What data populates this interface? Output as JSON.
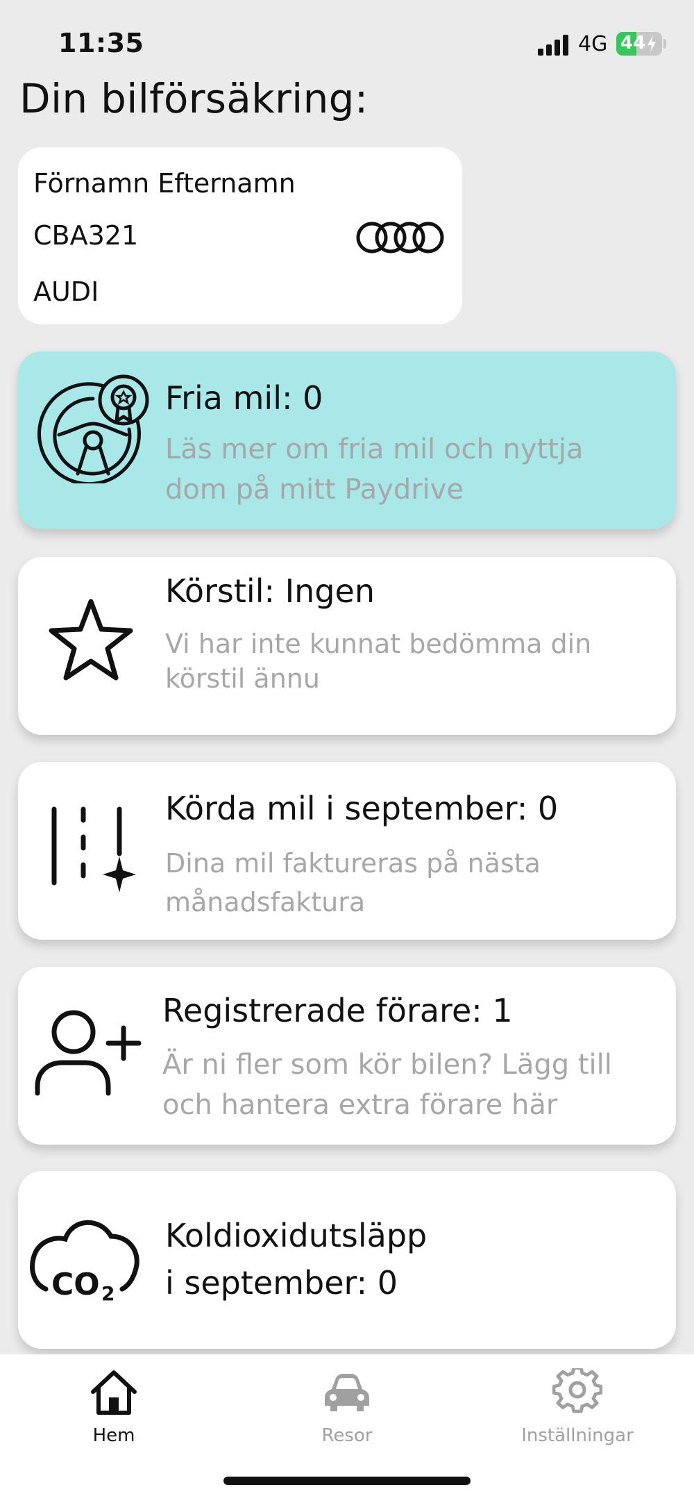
{
  "status_bar": {
    "time": "11:35",
    "network": "4G",
    "battery": "44",
    "battery_level_percent": 44,
    "battery_color": "#34c759"
  },
  "page": {
    "title": "Din bilförsäkring:"
  },
  "car": {
    "owner": "Förnamn Efternamn",
    "plate": "CBA321",
    "brand": "AUDI",
    "logo_icon": "audi-rings-logo"
  },
  "cards": {
    "free_miles": {
      "title": "Fria mil: 0",
      "description": "Läs mer om fria mil och nyttja dom på mitt Paydrive",
      "icon": "steering-wheel-award-icon",
      "background": "#a9e8e8"
    },
    "driving_style": {
      "title": "Körstil: Ingen",
      "description": "Vi har inte kunnat bedömma din körstil ännu",
      "icon": "star-icon"
    },
    "driven_miles": {
      "title": "Körda mil i september: 0",
      "description": "Dina mil faktureras på nästa månadsfaktura",
      "icon": "road-plus-icon"
    },
    "drivers": {
      "title": "Registrerade förare: 1",
      "description": "Är ni fler som kör bilen? Lägg till och hantera extra förare här",
      "icon": "add-user-icon"
    },
    "co2": {
      "title_line1": "Koldioxidutsläpp",
      "title_line2": "i september: 0",
      "icon": "co2-cloud-icon"
    }
  },
  "tab_bar": {
    "tabs": [
      {
        "label": "Hem",
        "icon": "home-icon",
        "active": true
      },
      {
        "label": "Resor",
        "icon": "car-icon",
        "active": false
      },
      {
        "label": "Inställningar",
        "icon": "gear-icon",
        "active": false
      }
    ]
  }
}
